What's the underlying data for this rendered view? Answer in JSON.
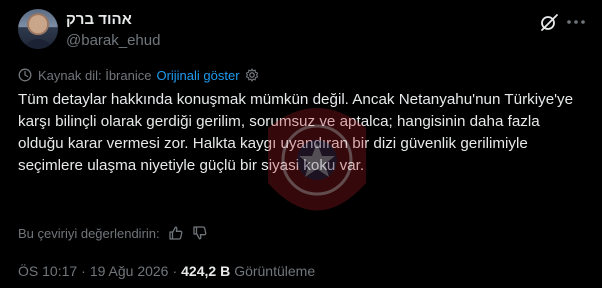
{
  "author": {
    "display_name": "אהוד ברק",
    "handle": "@barak_ehud"
  },
  "translation": {
    "source_label": "Kaynak dil: İbranice",
    "show_original_label": "Orijinali göster"
  },
  "tweet": {
    "text": "Tüm detaylar hakkında konuşmak mümkün değil. Ancak Netanyahu'nun Türkiye'ye karşı bilinçli olarak gerdiği gerilim, sorumsuz ve aptalca; hangisinin daha fazla olduğu karar vermesi zor. Halkta kaygı uyandıran bir dizi güvenlik gerilimiyle seçimlere ulaşma niyetiyle güçlü bir siyasi koku var."
  },
  "rating": {
    "prompt": "Bu çeviriyi değerlendirin:"
  },
  "meta": {
    "time": "ÖS 10:17",
    "separator": "·",
    "date": "19 Ağu 2026",
    "views_count": "424,2 B",
    "views_label": "Görüntüleme"
  },
  "icons": {
    "grok": "grok-icon",
    "more": "more-icon",
    "translate": "clock-translate-icon",
    "settings": "gear-icon",
    "thumbs_up": "thumbs-up-icon",
    "thumbs_down": "thumbs-down-icon",
    "watermark": "seal-watermark"
  },
  "colors": {
    "background": "#000000",
    "text": "#e7e9ea",
    "secondary": "#71767b",
    "link": "#1d9bf0"
  }
}
